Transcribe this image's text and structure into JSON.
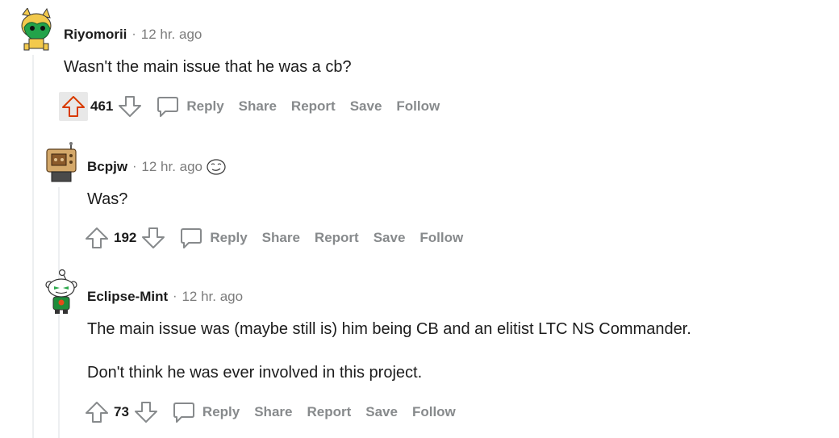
{
  "comments": [
    {
      "username": "Riyomorii",
      "separator": "·",
      "time": "12 hr. ago",
      "body": [
        "Wasn't the main issue that he was a cb?"
      ],
      "score": "461",
      "actions": {
        "reply": "Reply",
        "share": "Share",
        "report": "Report",
        "save": "Save",
        "follow": "Follow"
      }
    },
    {
      "username": "Bcpjw",
      "separator": "·",
      "time": "12 hr. ago",
      "body": [
        "Was?"
      ],
      "score": "192",
      "actions": {
        "reply": "Reply",
        "share": "Share",
        "report": "Report",
        "save": "Save",
        "follow": "Follow"
      }
    },
    {
      "username": "Eclipse-Mint",
      "separator": "·",
      "time": "12 hr. ago",
      "body": [
        "The main issue was (maybe still is) him being CB and an elitist LTC NS Commander.",
        "Don't think he was ever involved in this project."
      ],
      "score": "73",
      "actions": {
        "reply": "Reply",
        "share": "Share",
        "report": "Report",
        "save": "Save",
        "follow": "Follow"
      }
    }
  ],
  "colors": {
    "upvote_active": "#d93a00",
    "muted": "#878a8c",
    "thread_line": "#edeff1"
  },
  "icons": [
    "upvote-icon",
    "downvote-icon",
    "reply-bubble-icon",
    "emoji-flair-icon"
  ]
}
